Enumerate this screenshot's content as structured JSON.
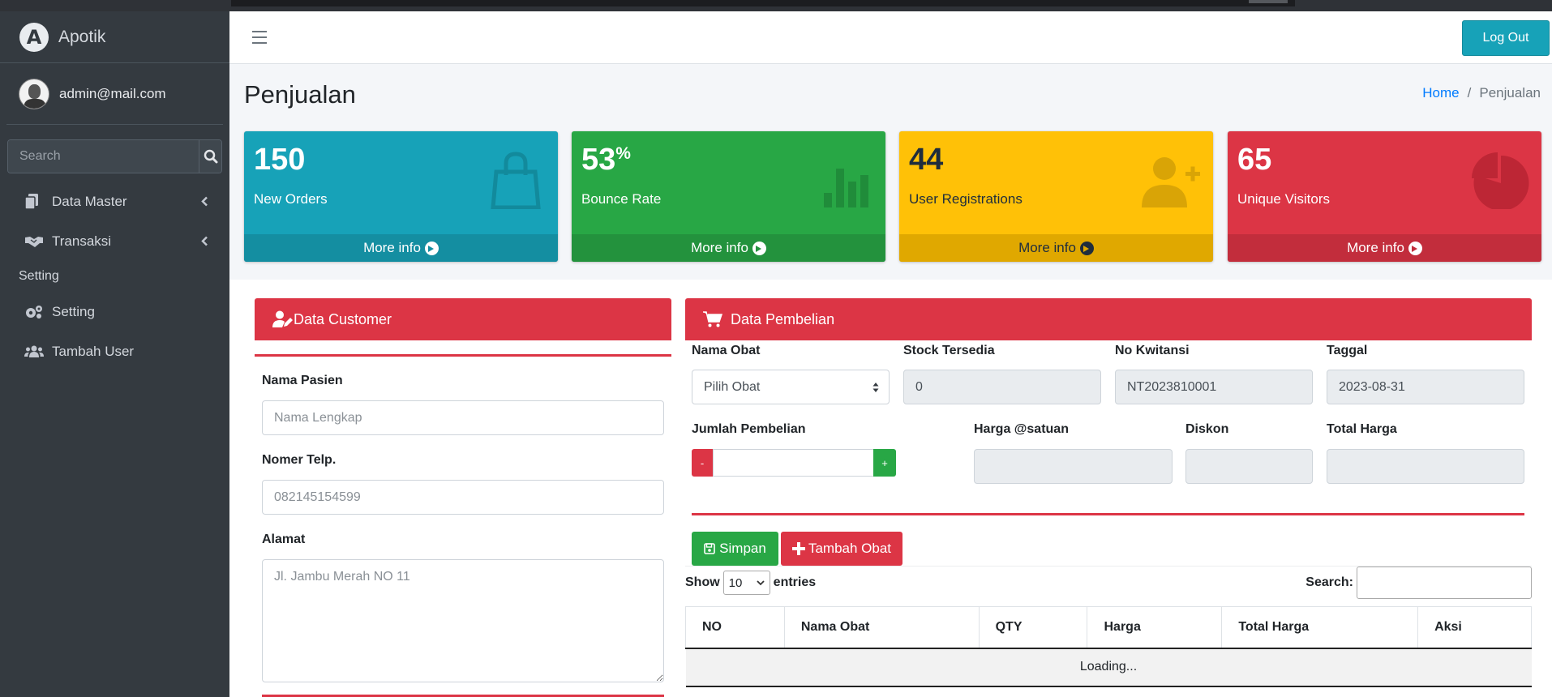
{
  "app": {
    "brand": "Apotik",
    "user_email": "admin@mail.com"
  },
  "sidebar": {
    "search_placeholder": "Search",
    "items": [
      {
        "label": "Data Master",
        "icon": "copy-icon"
      },
      {
        "label": "Transaksi",
        "icon": "handshake-icon"
      }
    ],
    "header": "Setting",
    "settings_items": [
      {
        "label": "Setting",
        "icon": "cogs-icon"
      },
      {
        "label": "Tambah User",
        "icon": "users-icon"
      }
    ]
  },
  "topnav": {
    "logout_label": "Log Out"
  },
  "page": {
    "title": "Penjualan",
    "breadcrumb": {
      "home": "Home",
      "current": "Penjualan"
    }
  },
  "stats": [
    {
      "value": "150",
      "suffix": "",
      "label": "New Orders",
      "more": "More info",
      "color": "#17a2b8",
      "icon": "shopping-bag-icon"
    },
    {
      "value": "53",
      "suffix": "%",
      "label": "Bounce Rate",
      "more": "More info",
      "color": "#28a745",
      "icon": "bar-chart-icon"
    },
    {
      "value": "44",
      "suffix": "",
      "label": "User Registrations",
      "more": "More info",
      "color": "#ffc107",
      "icon": "user-plus-icon"
    },
    {
      "value": "65",
      "suffix": "",
      "label": "Unique Visitors",
      "more": "More info",
      "color": "#dc3545",
      "icon": "pie-chart-icon"
    }
  ],
  "customer": {
    "title": "Data Customer",
    "nama_label": "Nama Pasien",
    "nama_placeholder": "Nama Lengkap",
    "telp_label": "Nomer Telp.",
    "telp_placeholder": "082145154599",
    "alamat_label": "Alamat",
    "alamat_placeholder": "Jl. Jambu Merah NO 11"
  },
  "pembelian": {
    "title": "Data Pembelian",
    "nama_obat_label": "Nama Obat",
    "nama_obat_value": "Pilih Obat",
    "stock_label": "Stock Tersedia",
    "stock_value": "0",
    "kwitansi_label": "No Kwitansi",
    "kwitansi_value": "NT2023810001",
    "tanggal_label": "Taggal",
    "tanggal_value": "2023-08-31",
    "jumlah_label": "Jumlah Pembelian",
    "minus": "-",
    "plus": "+",
    "harga_label": "Harga @satuan",
    "diskon_label": "Diskon",
    "total_label": "Total Harga",
    "simpan_label": "Simpan",
    "tambah_label": "Tambah Obat"
  },
  "table": {
    "show_label": "Show",
    "entries_value": "10",
    "entries_label": "entries",
    "search_label": "Search:",
    "columns": [
      "NO",
      "Nama Obat",
      "QTY",
      "Harga",
      "Total Harga",
      "Aksi"
    ],
    "loading": "Loading..."
  }
}
